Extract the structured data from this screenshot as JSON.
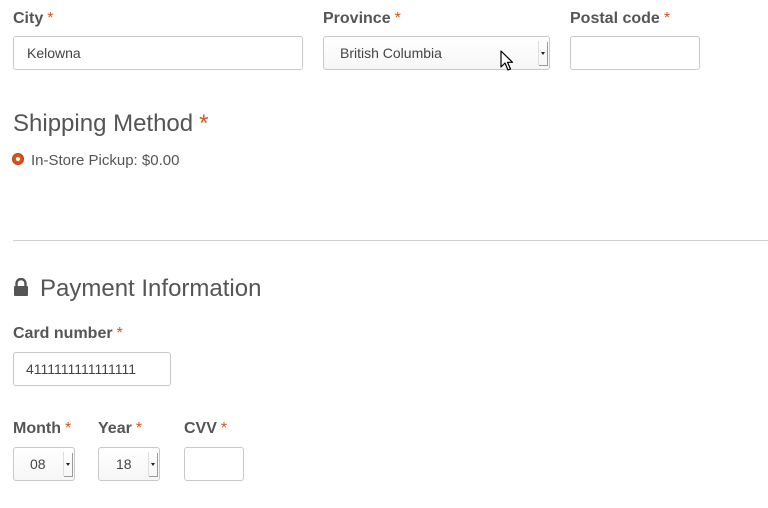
{
  "accent_color": "#d9531e",
  "required_marker": "*",
  "address": {
    "city": {
      "label": "City",
      "value": "Kelowna"
    },
    "province": {
      "label": "Province",
      "value": "British Columbia"
    },
    "postal": {
      "label": "Postal code",
      "value": ""
    }
  },
  "shipping": {
    "title": "Shipping Method",
    "options": [
      {
        "label": "In-Store Pickup: $0.00",
        "selected": true
      }
    ]
  },
  "payment": {
    "title": "Payment Information",
    "icon": "lock-icon",
    "card_number": {
      "label": "Card number",
      "value": "4111111111111111"
    },
    "month": {
      "label": "Month",
      "value": "08"
    },
    "year": {
      "label": "Year",
      "value": "18"
    },
    "cvv": {
      "label": "CVV",
      "value": ""
    }
  }
}
